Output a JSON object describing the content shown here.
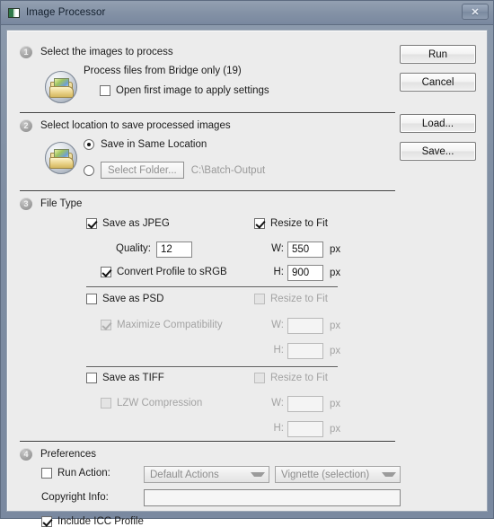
{
  "window": {
    "title": "Image Processor",
    "title_icon": "image-processor-icon",
    "close_label": "✕"
  },
  "buttons": {
    "run": "Run",
    "cancel": "Cancel",
    "load": "Load...",
    "save": "Save..."
  },
  "sections": {
    "step1": {
      "number": "1",
      "title": "Select the images to process",
      "source_text": "Process files from Bridge only (19)",
      "open_first": {
        "label": "Open first image to apply settings",
        "checked": false
      }
    },
    "step2": {
      "number": "2",
      "title": "Select location to save processed images",
      "same_location": {
        "label": "Save in Same Location",
        "selected": true
      },
      "select_folder": {
        "label": "Select Folder...",
        "selected": false,
        "path": "C:\\Batch-Output"
      }
    },
    "step3": {
      "number": "3",
      "title": "File Type",
      "jpeg": {
        "save_label": "Save as JPEG",
        "save_checked": true,
        "quality_label": "Quality:",
        "quality_value": "12",
        "convert_label": "Convert Profile to sRGB",
        "convert_checked": true,
        "resize_label": "Resize to Fit",
        "resize_checked": true,
        "w_label": "W:",
        "w_value": "550",
        "h_label": "H:",
        "h_value": "900",
        "unit": "px"
      },
      "psd": {
        "save_label": "Save as PSD",
        "save_checked": false,
        "maximize_label": "Maximize Compatibility",
        "maximize_checked": true,
        "resize_label": "Resize to Fit",
        "resize_checked": false,
        "w_label": "W:",
        "w_value": "",
        "h_label": "H:",
        "h_value": "",
        "unit": "px"
      },
      "tiff": {
        "save_label": "Save as TIFF",
        "save_checked": false,
        "lzw_label": "LZW Compression",
        "lzw_checked": false,
        "resize_label": "Resize to Fit",
        "resize_checked": false,
        "w_label": "W:",
        "w_value": "",
        "h_label": "H:",
        "h_value": "",
        "unit": "px"
      }
    },
    "step4": {
      "number": "4",
      "title": "Preferences",
      "run_action": {
        "label": "Run Action:",
        "checked": false
      },
      "action_set": "Default Actions",
      "action_name": "Vignette (selection)",
      "copyright_label": "Copyright Info:",
      "copyright_value": "",
      "include_icc": {
        "label": "Include ICC Profile",
        "checked": true
      }
    }
  },
  "colors": {
    "titlebar": "#8492a6",
    "panel": "#ececec",
    "frame": "#7a89a0",
    "text": "#1b1b1b",
    "disabled_text": "#a3a3a3"
  }
}
